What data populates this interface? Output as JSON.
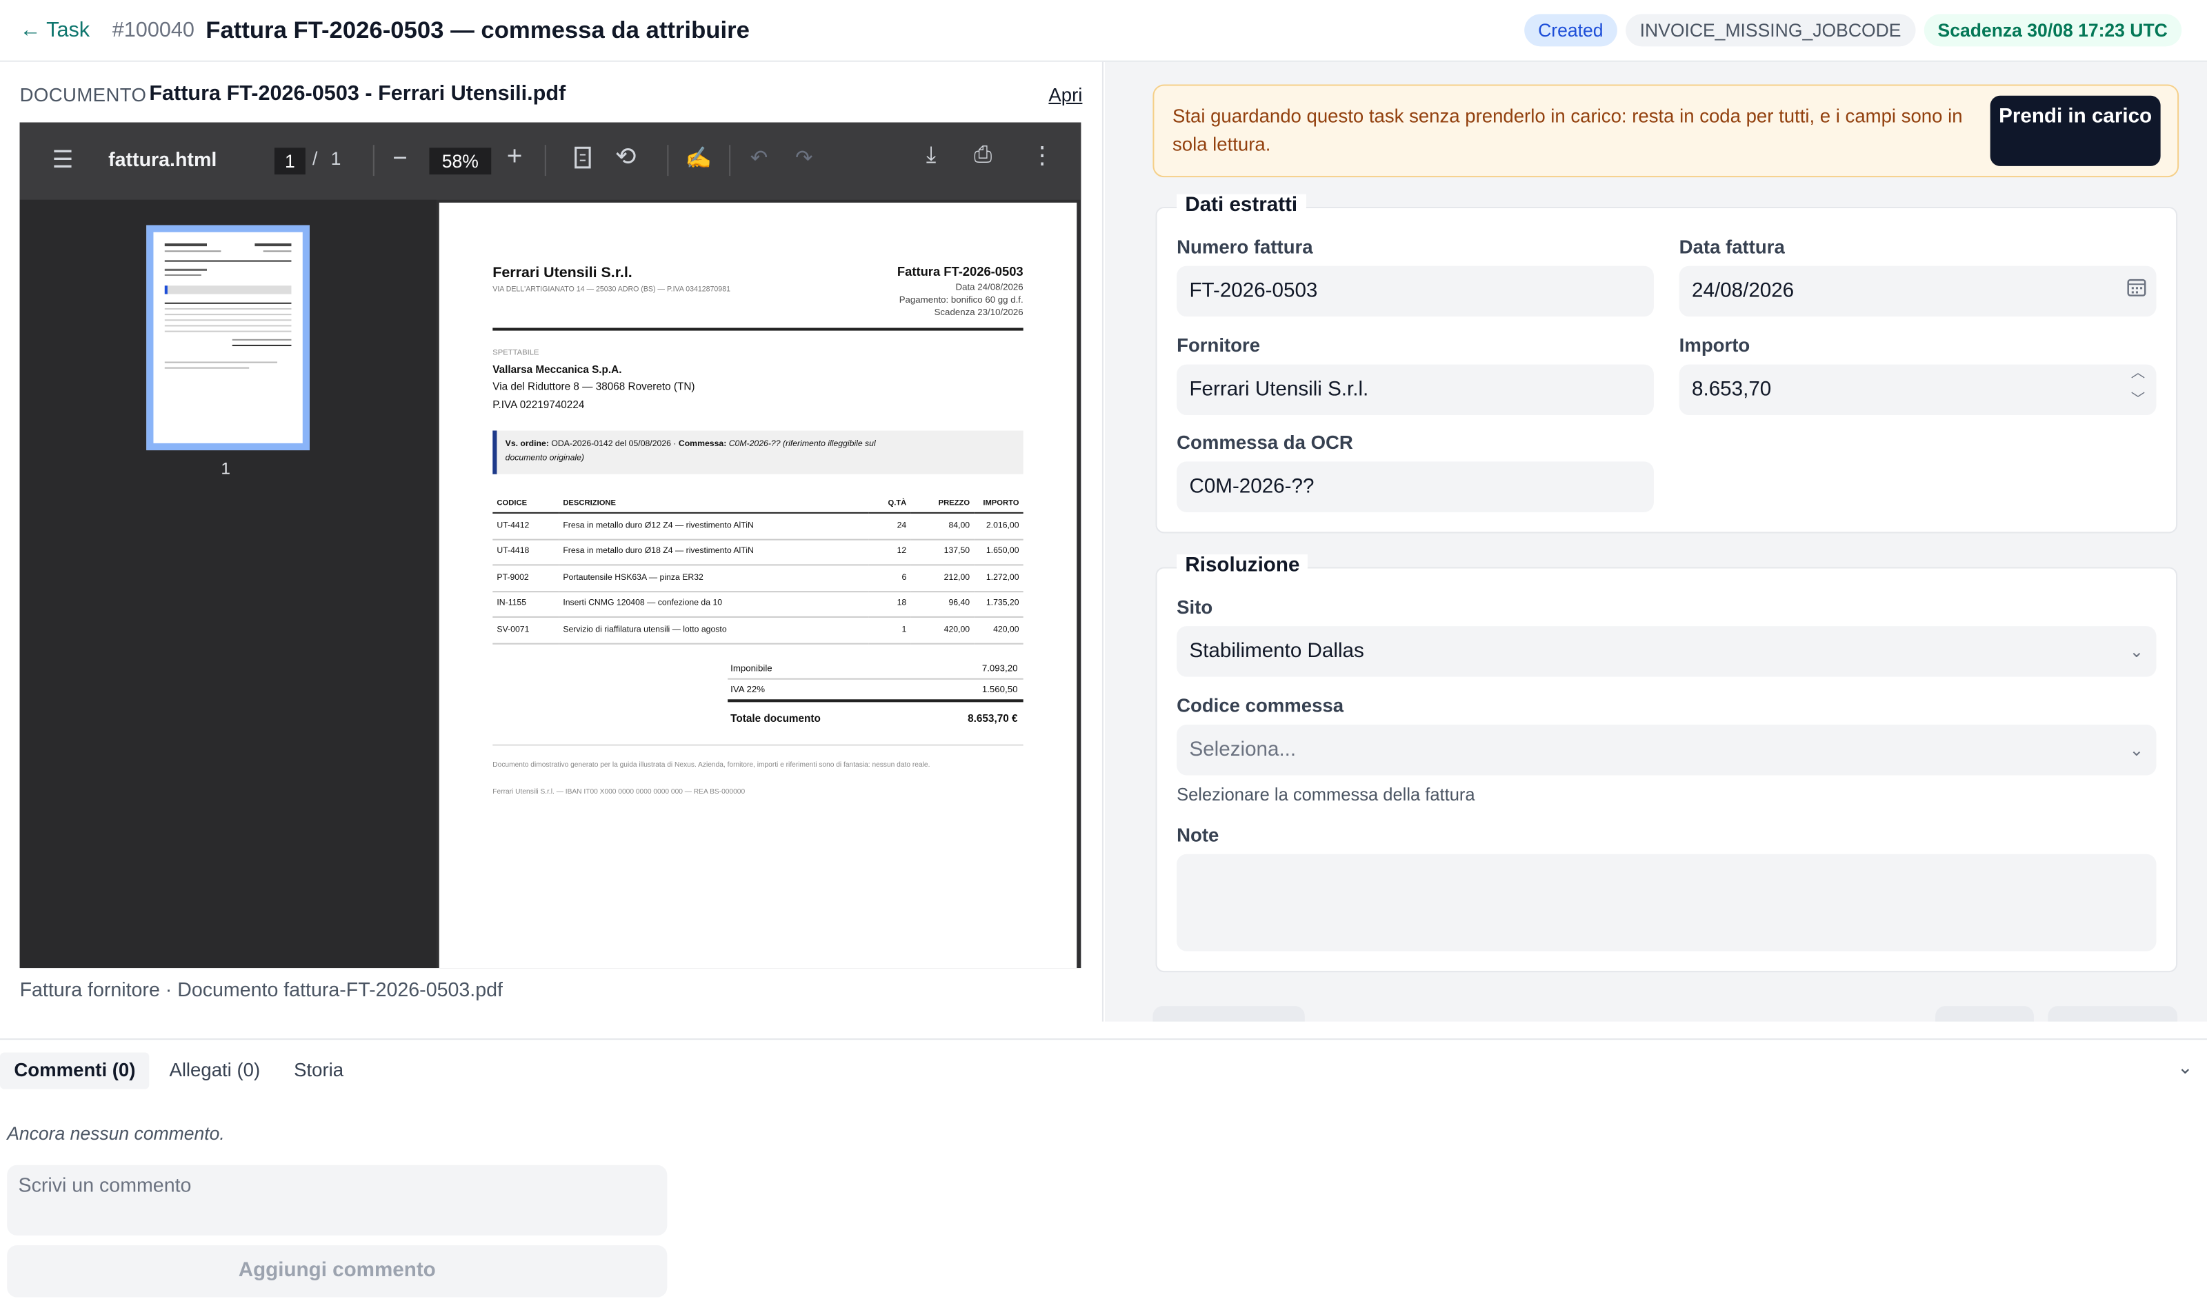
{
  "header": {
    "back": "← Task",
    "task_id": "#100040",
    "title": "Fattura FT-2026-0503 — commessa da attribuire",
    "badges": {
      "status": "Created",
      "code": "INVOICE_MISSING_JOBCODE",
      "due": "Scadenza 30/08 17:23 UTC"
    }
  },
  "document": {
    "label": "DOCUMENTO",
    "name": "Fattura FT-2026-0503 - Ferrari Utensili.pdf",
    "open": "Apri",
    "caption": "Fattura fornitore · Documento fattura-FT-2026-0503.pdf",
    "viewer": {
      "filename": "fattura.html",
      "page": "1",
      "of": "/",
      "total": "1",
      "zoom": "58%",
      "thumb_num": "1"
    },
    "invoice": {
      "supplier": "Ferrari Utensili S.r.l.",
      "supplier_addr": "VIA DELL'ARTIGIANATO 14 — 25030 ADRO (BS) — P.IVA 03412870981",
      "number": "Fattura FT-2026-0503",
      "date": "Data 24/08/2026",
      "payment": "Pagamento: bonifico 60 gg d.f.",
      "due": "Scadenza 23/10/2026",
      "to_label": "SPETTABILE",
      "to_name": "Vallarsa Meccanica S.p.A.",
      "to_addr": "Via del Riduttore 8 — 38068 Rovereto (TN)",
      "to_vat": "P.IVA 02219740224",
      "ref_order_label": "Vs. ordine:",
      "ref_order": "ODA-2026-0142 del 05/08/2026 ·",
      "ref_job_label": "Commessa:",
      "ref_job": "C0M-2026-?? (riferimento illeggibile sul",
      "ref_job2": "documento originale)",
      "cols": [
        "CODICE",
        "DESCRIZIONE",
        "Q.TÀ",
        "PREZZO",
        "IMPORTO"
      ],
      "rows": [
        [
          "UT-4412",
          "Fresa in metallo duro Ø12 Z4 — rivestimento AlTiN",
          "24",
          "84,00",
          "2.016,00"
        ],
        [
          "UT-4418",
          "Fresa in metallo duro Ø18 Z4 — rivestimento AlTiN",
          "12",
          "137,50",
          "1.650,00"
        ],
        [
          "PT-9002",
          "Portautensile HSK63A — pinza ER32",
          "6",
          "212,00",
          "1.272,00"
        ],
        [
          "IN-1155",
          "Inserti CNMG 120408 — confezione da 10",
          "18",
          "96,40",
          "1.735,20"
        ],
        [
          "SV-0071",
          "Servizio di riaffilatura utensili — lotto agosto",
          "1",
          "420,00",
          "420,00"
        ]
      ],
      "taxable_label": "Imponibile",
      "taxable": "7.093,20",
      "vat_label": "IVA 22%",
      "vat": "1.560,50",
      "total_label": "Totale documento",
      "total": "8.653,70 €",
      "foot1": "Documento dimostrativo generato per la guida illustrata di Nexus. Azienda, fornitore, importi e riferimenti sono di fantasia: nessun",
      "foot1b": "dato reale.",
      "foot2": "Ferrari Utensili S.r.l. — IBAN IT00 X000 0000 0000 0000 000 — REA BS-000000"
    }
  },
  "notice": {
    "text": "Stai guardando questo task senza prenderlo in carico: resta in coda per tutti, e i campi sono in sola lettura.",
    "button": "Prendi in carico"
  },
  "extracted": {
    "legend": "Dati estratti",
    "invoice_number": {
      "label": "Numero fattura",
      "value": "FT-2026-0503"
    },
    "invoice_date": {
      "label": "Data fattura",
      "value": "24/08/2026"
    },
    "supplier": {
      "label": "Fornitore",
      "value": "Ferrari Utensili S.r.l."
    },
    "amount": {
      "label": "Importo",
      "value": "8.653,70"
    },
    "ocr_job": {
      "label": "Commessa da OCR",
      "value": "C0M-2026-??"
    }
  },
  "resolution": {
    "legend": "Risoluzione",
    "site": {
      "label": "Sito",
      "value": "Stabilimento Dallas"
    },
    "job_code": {
      "label": "Codice commessa",
      "placeholder": "Seleziona...",
      "help": "Selezionare la commessa della fattura"
    },
    "notes": {
      "label": "Note",
      "value": ""
    }
  },
  "bottom": {
    "tabs": [
      "Commenti (0)",
      "Allegati (0)",
      "Storia"
    ],
    "empty": "Ancora nessun commento.",
    "placeholder": "Scrivi un commento",
    "add": "Aggiungi commento"
  }
}
